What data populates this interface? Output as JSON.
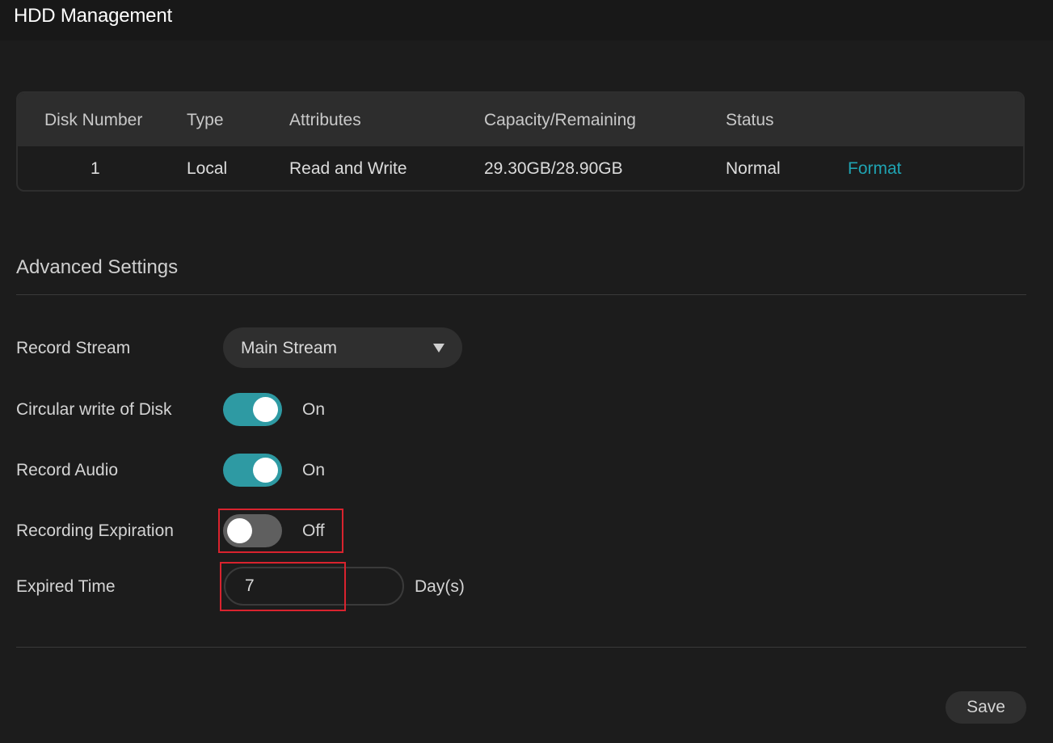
{
  "header": {
    "title": "HDD Management"
  },
  "disk_table": {
    "columns": [
      "Disk Number",
      "Type",
      "Attributes",
      "Capacity/Remaining",
      "Status"
    ],
    "rows": [
      {
        "disk_number": "1",
        "type": "Local",
        "attributes": "Read and Write",
        "capacity_remaining": "29.30GB/28.90GB",
        "status": "Normal",
        "action": "Format"
      }
    ]
  },
  "advanced": {
    "title": "Advanced Settings",
    "record_stream": {
      "label": "Record Stream",
      "value": "Main Stream"
    },
    "circular_write": {
      "label": "Circular write of Disk",
      "state": "On"
    },
    "record_audio": {
      "label": "Record Audio",
      "state": "On"
    },
    "recording_expiration": {
      "label": "Recording Expiration",
      "state": "Off"
    },
    "expired_time": {
      "label": "Expired Time",
      "value": "7",
      "unit": "Day(s)"
    }
  },
  "footer": {
    "save_label": "Save"
  },
  "colors": {
    "accent": "#2e9aa3",
    "link": "#1fa3b2",
    "highlight": "#d9232e",
    "background": "#1c1c1c"
  }
}
